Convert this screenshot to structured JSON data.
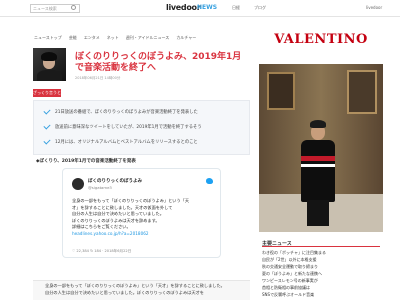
{
  "header": {
    "search_placeholder": "ニュース検索",
    "logo": "livedoor",
    "logo_sub": "NEWS",
    "links": [
      "日経",
      "ブログ",
      "livedoor"
    ]
  },
  "breadcrumb": [
    "ニューストップ",
    "芸能",
    "エンタメ",
    "ネット",
    "週刊・アイドルニュース",
    "カルチャー"
  ],
  "article": {
    "title": "ぼくのりりっくのぼうよみ、2019年1月で音楽活動を終了へ",
    "meta": "2018年06月21日 14時00分",
    "tag": "ざっくり言うと",
    "summary": [
      "21日放送の番組で、ぼくのりりっくのぼうよみが音楽活動終了を発表した",
      "放送前に意味深なツイートをしていたが、2019年1月で活動を終了するそう",
      "12月には、オリジナルアルバムとベストアルバムをリリースするとのこと"
    ],
    "section_head": "◆ぼくりり、2019年1月での音楽活動終了を発表"
  },
  "tweet": {
    "name": "ぼくのりりっくのぼうよみ",
    "handle": "@sigatame3",
    "body_lines": [
      "全身の一部をもって「ぼくのりりっくのぼうよみ」という「天",
      "才」を辞することに致しました。天才の仮面を外して"
    ],
    "body_line3": "…",
    "body_line4": "自分の人生は自分で決めたいと思っていました。",
    "body_line5": "ぼくのりりっくのぼうよみは天才を辞めます。",
    "body_line6": "詳細はこちらをご覧ください。",
    "link": "headlines.yahoo.co.jp/h?a=2018062",
    "stats": "♡ 22,384   ↻ 184 · 2018年6月22日"
  },
  "quote": {
    "line1": "全身の一部をもって「ぼくのりりっくのぼうよみ」という「天才」を辞することに致しました。",
    "line2": "自分の人生は自分で決めたいと思っていました。ぼくのりりっくのぼうよみは天才を"
  },
  "ad": {
    "brand": "VALENTINO"
  },
  "side_news": {
    "title": "主要ニュース",
    "items": [
      "わき役の「ボッチャ」に注目集まる",
      "自民が「2世」以外に本格支援",
      "秋の交通安全運動で取り締まり",
      "夏の「ぼうよみ」と新たな連携へ",
      "ワンピースレモン号の新事実が",
      "首相と防衛相の事前協議は",
      "SNSで反響呼ぶオールド音楽"
    ]
  }
}
